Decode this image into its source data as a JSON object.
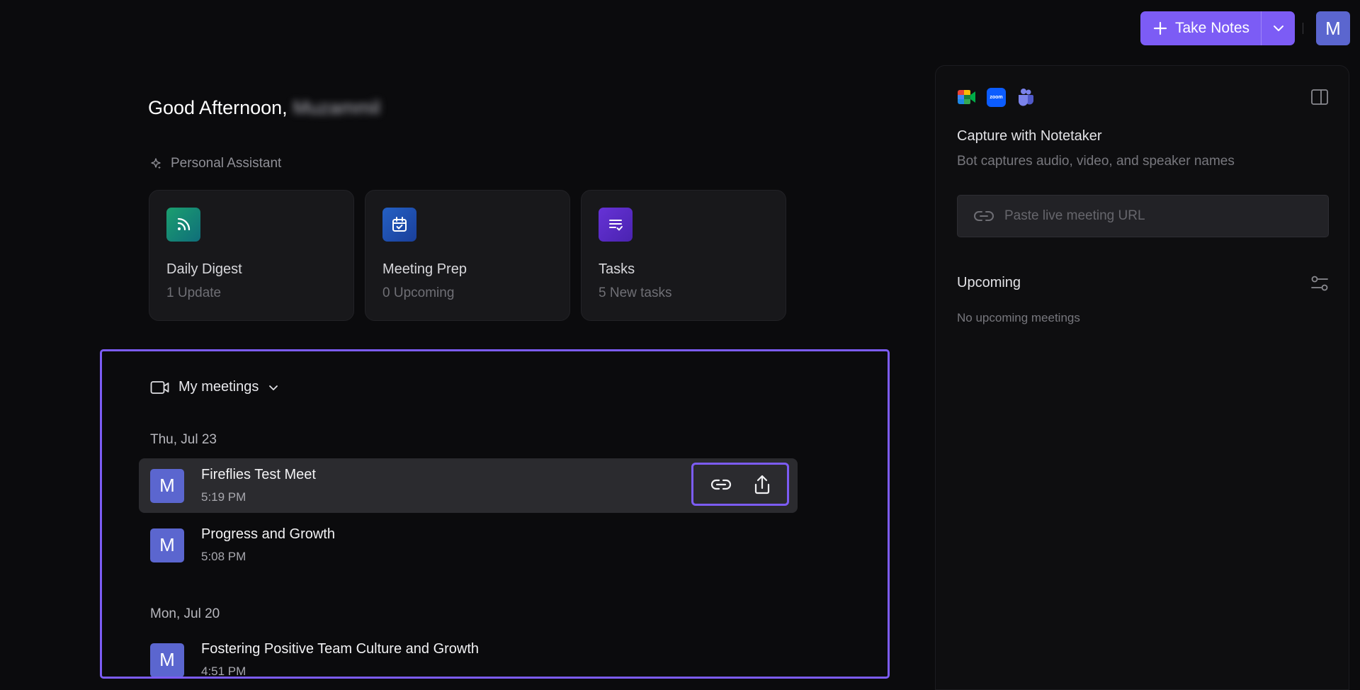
{
  "toolbar": {
    "take_notes_label": "Take Notes",
    "avatar_initial": "M",
    "accent_color": "#7c5cf5"
  },
  "greeting": {
    "prefix": "Good Afternoon,",
    "user_name": "Muzammil"
  },
  "assistant": {
    "label": "Personal Assistant",
    "icon": "sparkle-icon"
  },
  "cards": [
    {
      "title": "Daily Digest",
      "subtitle": "1 Update",
      "icon": "rss-icon",
      "color": "#17a06a"
    },
    {
      "title": "Meeting Prep",
      "subtitle": "0 Upcoming",
      "icon": "calendar-check-icon",
      "color": "#1f5bb8"
    },
    {
      "title": "Tasks",
      "subtitle": "5 New tasks",
      "icon": "task-list-icon",
      "color": "#5b2fc9"
    }
  ],
  "meetings": {
    "header_label": "My meetings",
    "groups": [
      {
        "date": "Thu, Jul 23",
        "items": [
          {
            "avatar": "M",
            "title": "Fireflies Test Meet",
            "time": "5:19 PM"
          },
          {
            "avatar": "M",
            "title": "Progress and Growth",
            "time": "5:08 PM"
          }
        ]
      },
      {
        "date": "Mon, Jul 20",
        "items": [
          {
            "avatar": "M",
            "title": "Fostering Positive Team Culture and Growth",
            "time": "4:51 PM"
          }
        ]
      }
    ]
  },
  "panel": {
    "platform_icons": [
      "google-meet-icon",
      "zoom-icon",
      "teams-icon"
    ],
    "zoom_badge": "zoom",
    "capture_title": "Capture with Notetaker",
    "capture_subtitle": "Bot captures audio, video, and speaker names",
    "url_placeholder": "Paste live meeting URL",
    "upcoming_title": "Upcoming",
    "no_upcoming": "No upcoming meetings"
  }
}
